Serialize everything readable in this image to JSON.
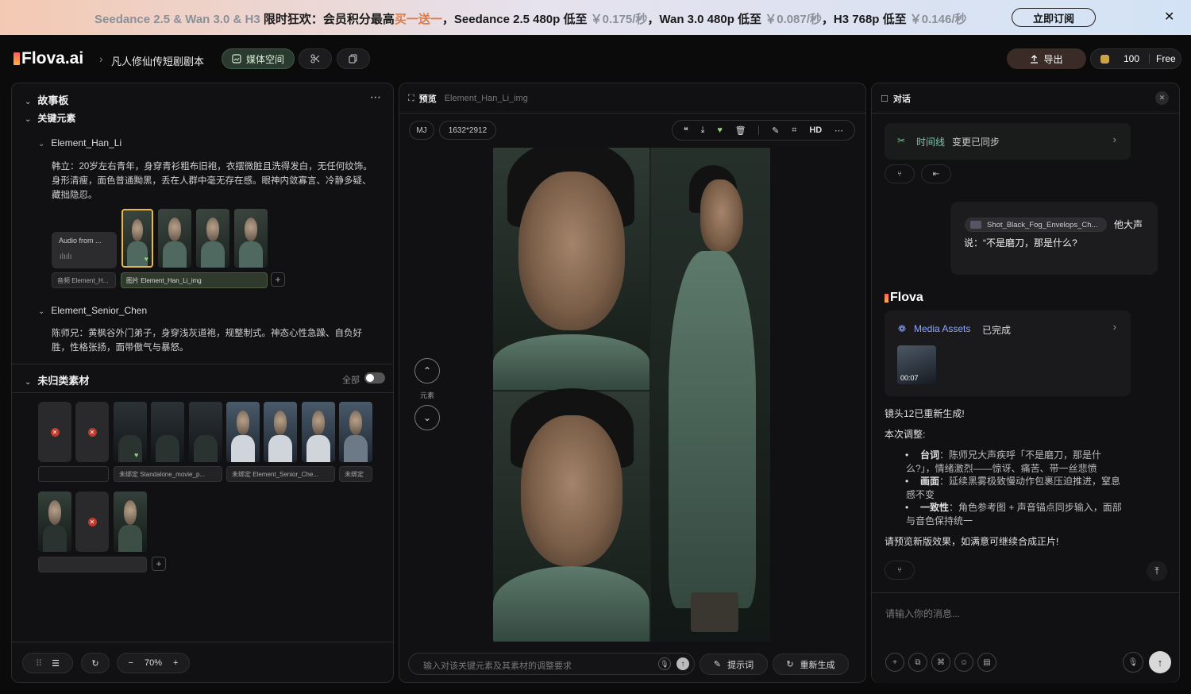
{
  "banner": {
    "part1": "Seedance 2.5 & Wan 3.0 & H3",
    "part2": " 限时狂欢：会员积分最高",
    "part3": "买一送一",
    "part4": "，Seedance 2.5 480p 低至 ",
    "price1": "￥0.175/秒",
    "part5": "，Wan 3.0 480p 低至 ",
    "price2": "￥0.087/秒",
    "part6": "，H3 768p 低至 ",
    "price3": "￥0.146/秒",
    "cta": "立即订阅",
    "close": "✕"
  },
  "header": {
    "logo": "Flova.ai",
    "sep": "›",
    "project": "凡人修仙传短剧剧本",
    "media_space": "媒体空间",
    "export": "导出",
    "credits": "100",
    "plan": "Free"
  },
  "storyboard": {
    "title": "故事板",
    "key_elements": "关键元素",
    "el1": {
      "name": "Element_Han_Li",
      "desc": "韩立：20岁左右青年，身穿青衫粗布旧袍，衣摆微脏且洗得发白，无任何纹饰。身形清瘦，面色普通黝黑，丢在人群中毫无存在感。眼神内敛寡言、冷静多疑、藏拙隐忍。",
      "audio_label": "Audio from ...",
      "chip_audio": "音频  Element_H...",
      "chip_image": "图片  Element_Han_Li_img"
    },
    "el2": {
      "name": "Element_Senior_Chen",
      "desc": "陈师兄：黄枫谷外门弟子，身穿浅灰道袍，规整制式。神态心性急躁、自负好胜，性格张扬，面带傲气与暴怒。"
    },
    "unsorted": "未归类素材",
    "all": "全部",
    "chips": [
      "未绑定  Standalone_movie_p...",
      "未绑定  Element_Senior_Che...",
      "未绑定"
    ],
    "zoom": "70%"
  },
  "preview": {
    "title": "预览",
    "file": "Element_Han_Li_img",
    "model": "MJ",
    "size": "1632*2912",
    "hd": "HD",
    "element_label": "元素",
    "input_placeholder": "输入对该关键元素及其素材的调整要求",
    "prompt_btn": "提示词",
    "regen_btn": "重新生成"
  },
  "chat": {
    "title": "对话",
    "timeline": "时间线",
    "timeline_status": "变更已同步",
    "user_ref": "Shot_Black_Fog_Envelops_Ch...",
    "user_msg1": "他大声",
    "user_msg2": "说：“不是磨刀，那是什么?",
    "bot_name": "Flova",
    "assets_title": "Media Assets",
    "assets_status": "已完成",
    "duration": "00:07",
    "line1": "镜头12已重新生成!",
    "line2": "本次调整:",
    "b1_key": "台词",
    "b1_val": "：陈师兄大声疾呼「不是磨刀，那是什么?」，情绪激烈——惊讶、痛苦、带一丝悲愤",
    "b2_key": "画面",
    "b2_val": "：延续黑雾极致慢动作包裹压迫推进，窒息感不变",
    "b3_key": "一致性",
    "b3_val": "：角色参考图 + 声音锚点同步输入，面部与音色保持统一",
    "line3": "请预览新版效果，如满意可继续合成正片!",
    "input_placeholder": "请输入你的消息..."
  }
}
